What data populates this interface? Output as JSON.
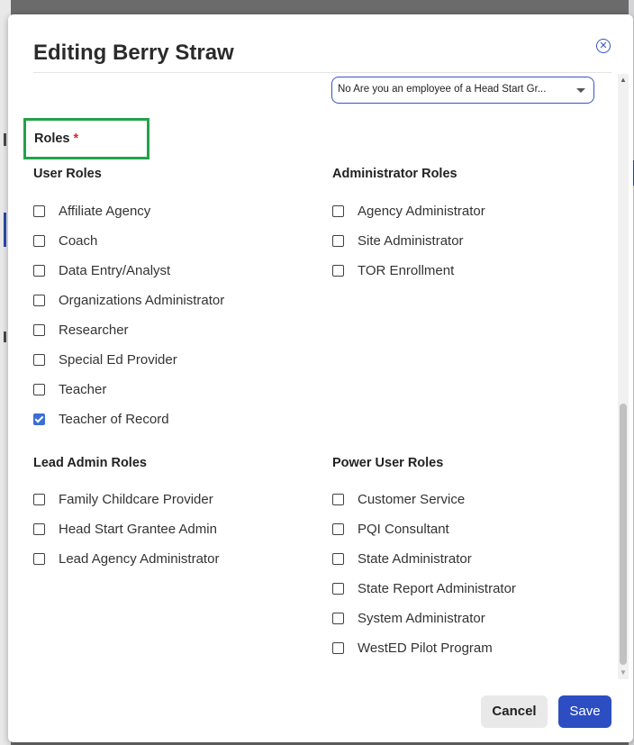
{
  "dialog": {
    "title": "Editing Berry Straw",
    "close_icon": "close-circle-icon",
    "select_value": "No Are you an employee of a Head Start Gr...",
    "roles_label": "Roles",
    "required_marker": "*",
    "cancel_label": "Cancel",
    "save_label": "Save"
  },
  "groups": {
    "user_roles": {
      "title": "User Roles",
      "items": [
        {
          "label": "Affiliate Agency",
          "checked": false
        },
        {
          "label": "Coach",
          "checked": false
        },
        {
          "label": "Data Entry/Analyst",
          "checked": false
        },
        {
          "label": "Organizations Administrator",
          "checked": false
        },
        {
          "label": "Researcher",
          "checked": false
        },
        {
          "label": "Special Ed Provider",
          "checked": false
        },
        {
          "label": "Teacher",
          "checked": false
        },
        {
          "label": "Teacher of Record",
          "checked": true
        }
      ]
    },
    "admin_roles": {
      "title": "Administrator Roles",
      "items": [
        {
          "label": "Agency Administrator",
          "checked": false
        },
        {
          "label": "Site Administrator",
          "checked": false
        },
        {
          "label": "TOR Enrollment",
          "checked": false
        }
      ]
    },
    "lead_admin_roles": {
      "title": "Lead Admin Roles",
      "items": [
        {
          "label": "Family Childcare Provider",
          "checked": false
        },
        {
          "label": "Head Start Grantee Admin",
          "checked": false
        },
        {
          "label": "Lead Agency Administrator",
          "checked": false
        }
      ]
    },
    "power_user_roles": {
      "title": "Power User Roles",
      "items": [
        {
          "label": "Customer Service",
          "checked": false
        },
        {
          "label": "PQI Consultant",
          "checked": false
        },
        {
          "label": "State Administrator",
          "checked": false
        },
        {
          "label": "State Report Administrator",
          "checked": false
        },
        {
          "label": "System Administrator",
          "checked": false
        },
        {
          "label": "WestED Pilot Program",
          "checked": false
        }
      ]
    }
  },
  "colors": {
    "accent": "#2d4ec2",
    "checked": "#3b6ed6",
    "highlight_box": "#21a34a",
    "required": "#d32f2f"
  }
}
